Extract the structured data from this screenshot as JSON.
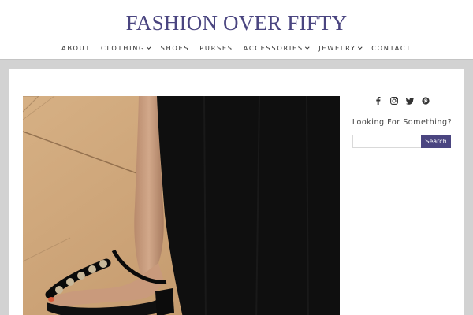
{
  "header": {
    "site_title": "FASHION OVER FIFTY",
    "nav": [
      {
        "label": "ABOUT",
        "dropdown": false
      },
      {
        "label": "CLOTHING",
        "dropdown": true
      },
      {
        "label": "SHOES",
        "dropdown": false
      },
      {
        "label": "PURSES",
        "dropdown": false
      },
      {
        "label": "ACCESSORIES",
        "dropdown": true
      },
      {
        "label": "JEWELRY",
        "dropdown": true
      },
      {
        "label": "CONTACT",
        "dropdown": false
      }
    ]
  },
  "sidebar": {
    "social_icons": [
      "facebook-icon",
      "instagram-icon",
      "twitter-icon",
      "pinterest-icon"
    ],
    "heading": "Looking For Something?",
    "search": {
      "placeholder": "",
      "button_label": "Search"
    }
  },
  "colors": {
    "brand": "#4a4580",
    "page_background": "#d2d2d2"
  }
}
